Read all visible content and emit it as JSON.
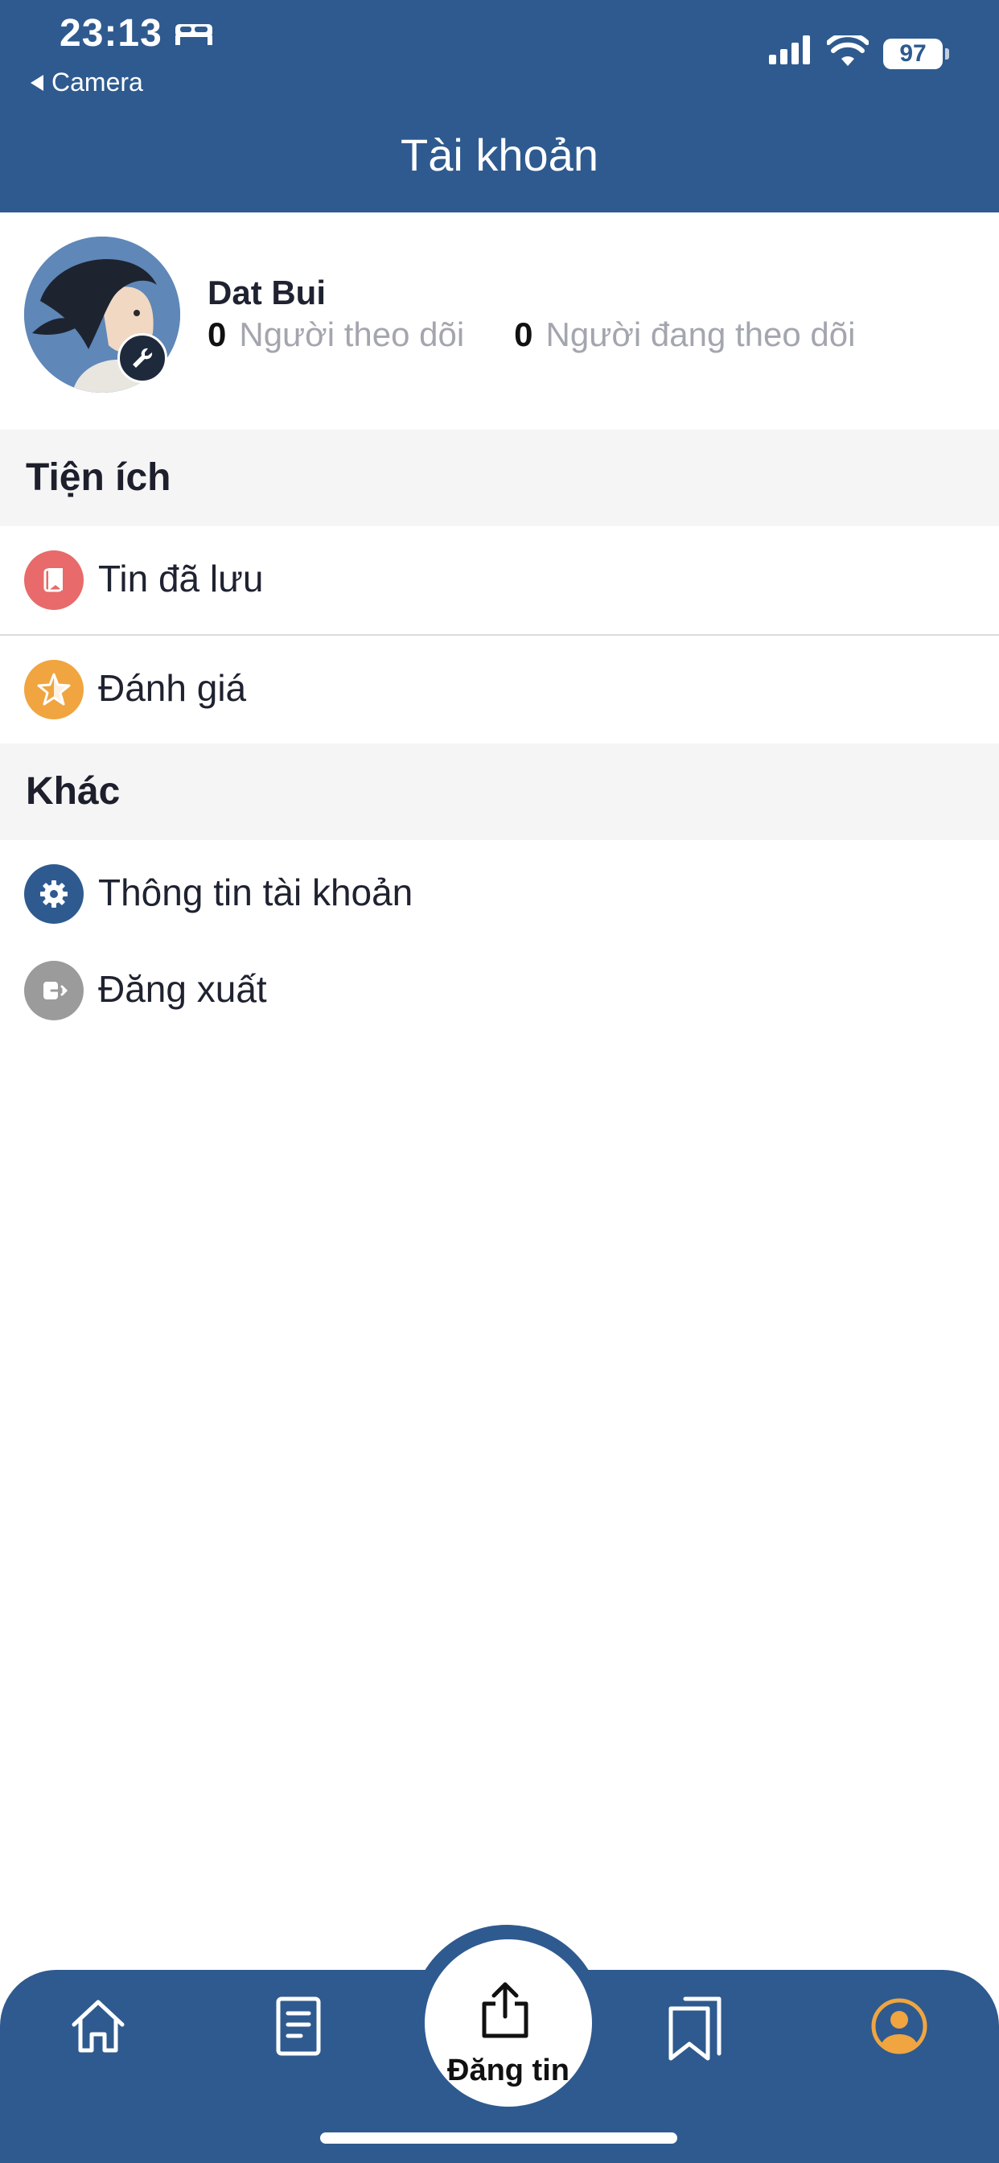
{
  "status": {
    "time": "23:13",
    "back_label": "Camera",
    "battery": "97"
  },
  "header": {
    "title": "Tài khoản"
  },
  "profile": {
    "name": "Dat Bui",
    "followers_count": "0",
    "followers_label": "Người theo dõi",
    "following_count": "0",
    "following_label": "Người đang theo dõi"
  },
  "sections": {
    "utilities": {
      "title": "Tiện ích",
      "items": [
        {
          "label": "Tin đã lưu",
          "icon": "bookmark-icon",
          "color": "#e86a6a"
        },
        {
          "label": "Đánh giá",
          "icon": "star-icon",
          "color": "#f0a540"
        }
      ]
    },
    "other": {
      "title": "Khác",
      "items": [
        {
          "label": "Thông tin tài khoản",
          "icon": "gear-icon",
          "color": "#2e5a8f"
        },
        {
          "label": "Đăng xuất",
          "icon": "logout-icon",
          "color": "#9b9b9b"
        }
      ]
    }
  },
  "tabbar": {
    "post_label": "Đăng tin",
    "active_tab": "account",
    "active_color": "#f0a540",
    "tabs": [
      "home-icon",
      "document-icon",
      "share-icon",
      "bookmarks-icon",
      "account-icon"
    ]
  },
  "colors": {
    "primary": "#2e5a8f",
    "section_bg": "#f5f5f6"
  }
}
